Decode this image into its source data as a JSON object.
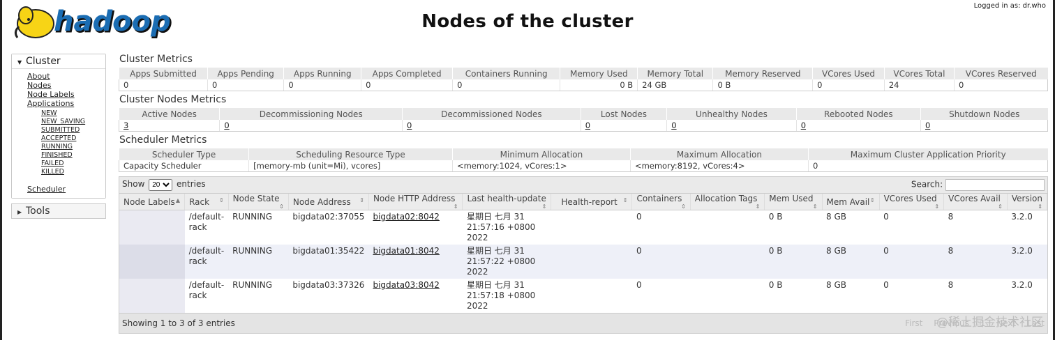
{
  "header": {
    "title": "Nodes of the cluster",
    "logged_in": "Logged in as: dr.who",
    "logo_text": "hadoop"
  },
  "nav": {
    "cluster_label": "Cluster",
    "items": [
      "About",
      "Nodes",
      "Node Labels",
      "Applications"
    ],
    "app_states": [
      "NEW",
      "NEW_SAVING",
      "SUBMITTED",
      "ACCEPTED",
      "RUNNING",
      "FINISHED",
      "FAILED",
      "KILLED"
    ],
    "scheduler": "Scheduler",
    "tools_label": "Tools"
  },
  "cluster_metrics": {
    "title": "Cluster Metrics",
    "headers": [
      "Apps Submitted",
      "Apps Pending",
      "Apps Running",
      "Apps Completed",
      "Containers Running",
      "Memory Used",
      "Memory Total",
      "Memory Reserved",
      "VCores Used",
      "VCores Total",
      "VCores Reserved"
    ],
    "values": [
      "0",
      "0",
      "0",
      "0",
      "0",
      "0 B",
      "24 GB",
      "0 B",
      "0",
      "24",
      "0"
    ]
  },
  "node_metrics": {
    "title": "Cluster Nodes Metrics",
    "headers": [
      "Active Nodes",
      "Decommissioning Nodes",
      "Decommissioned Nodes",
      "Lost Nodes",
      "Unhealthy Nodes",
      "Rebooted Nodes",
      "Shutdown Nodes"
    ],
    "values": [
      "3",
      "0",
      "0",
      "0",
      "0",
      "0",
      "0"
    ]
  },
  "scheduler_metrics": {
    "title": "Scheduler Metrics",
    "headers": [
      "Scheduler Type",
      "Scheduling Resource Type",
      "Minimum Allocation",
      "Maximum Allocation",
      "Maximum Cluster Application Priority"
    ],
    "values": [
      "Capacity Scheduler",
      "[memory-mb (unit=Mi), vcores]",
      "<memory:1024, vCores:1>",
      "<memory:8192, vCores:4>",
      "0"
    ]
  },
  "nodes_table": {
    "show_label": "Show",
    "entries_label": "entries",
    "page_size": "20",
    "search_label": "Search:",
    "headers": [
      "Node Labels",
      "Rack",
      "Node State",
      "Node Address",
      "Node HTTP Address",
      "Last health-update",
      "Health-report",
      "Containers",
      "Allocation Tags",
      "Mem Used",
      "Mem Avail",
      "VCores Used",
      "VCores Avail",
      "Version"
    ],
    "rows": [
      {
        "labels": "",
        "rack": "/default-rack",
        "state": "RUNNING",
        "address": "bigdata02:37055",
        "http": "bigdata02:8042",
        "health_date": "星期日 七月 31",
        "health_time": "21:57:16 +0800 2022",
        "report": "",
        "containers": "0",
        "tags": "",
        "mem_used": "0 B",
        "mem_avail": "8 GB",
        "vc_used": "0",
        "vc_avail": "8",
        "version": "3.2.0"
      },
      {
        "labels": "",
        "rack": "/default-rack",
        "state": "RUNNING",
        "address": "bigdata01:35422",
        "http": "bigdata01:8042",
        "health_date": "星期日 七月 31",
        "health_time": "21:57:22 +0800 2022",
        "report": "",
        "containers": "0",
        "tags": "",
        "mem_used": "0 B",
        "mem_avail": "8 GB",
        "vc_used": "0",
        "vc_avail": "8",
        "version": "3.2.0"
      },
      {
        "labels": "",
        "rack": "/default-rack",
        "state": "RUNNING",
        "address": "bigdata03:37326",
        "http": "bigdata03:8042",
        "health_date": "星期日 七月 31",
        "health_time": "21:57:18 +0800 2022",
        "report": "",
        "containers": "0",
        "tags": "",
        "mem_used": "0 B",
        "mem_avail": "8 GB",
        "vc_used": "0",
        "vc_avail": "8",
        "version": "3.2.0"
      }
    ],
    "info": "Showing 1 to 3 of 3 entries",
    "pager": [
      "First",
      "Previous",
      "1",
      "Next",
      "Last"
    ]
  },
  "watermark": "@稀土掘金技术社区"
}
